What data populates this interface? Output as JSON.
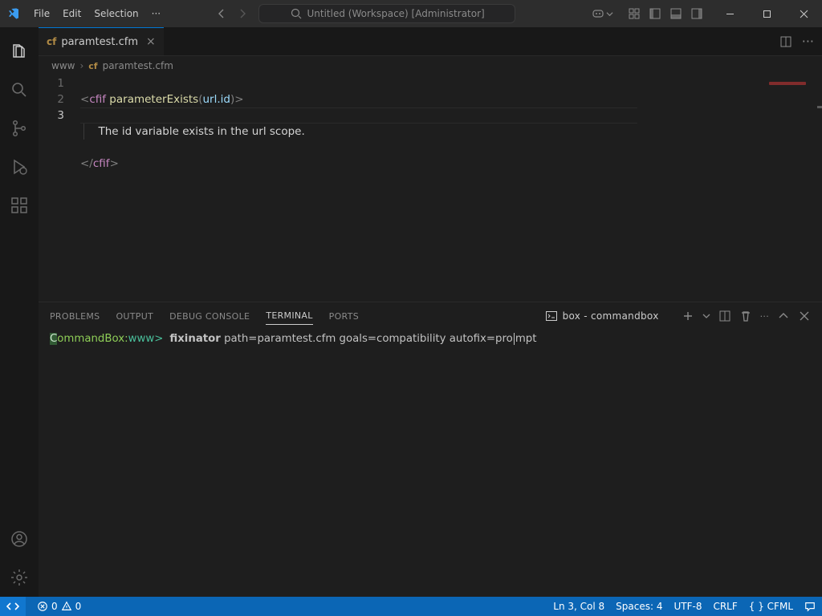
{
  "title": "Untitled (Workspace) [Administrator]",
  "menu": {
    "file": "File",
    "edit": "Edit",
    "selection": "Selection"
  },
  "tab": {
    "filename": "paramtest.cfm"
  },
  "crumbs": {
    "root": "www",
    "file": "paramtest.cfm"
  },
  "code": {
    "lines": [
      "1",
      "2",
      "3"
    ],
    "l1_raw": "<cfif parameterExists(url.id)>",
    "l2": "  The id variable exists in the url scope.",
    "l3_raw": "</cfif>"
  },
  "panel": {
    "tabs": {
      "problems": "PROBLEMS",
      "output": "OUTPUT",
      "debug": "DEBUG CONSOLE",
      "terminal": "TERMINAL",
      "ports": "PORTS"
    },
    "term_launcher": "box - commandbox"
  },
  "terminal": {
    "prompt_host": "CommandBox:",
    "prompt_path": "www>",
    "command": "fixinator path=paramtest.cfm goals=compatibility autofix=prompt"
  },
  "status": {
    "errors": "0",
    "warnings": "0",
    "ln_col": "Ln 3, Col 8",
    "spaces": "Spaces: 4",
    "encoding": "UTF-8",
    "eol": "CRLF",
    "lang": "{ } CFML"
  }
}
